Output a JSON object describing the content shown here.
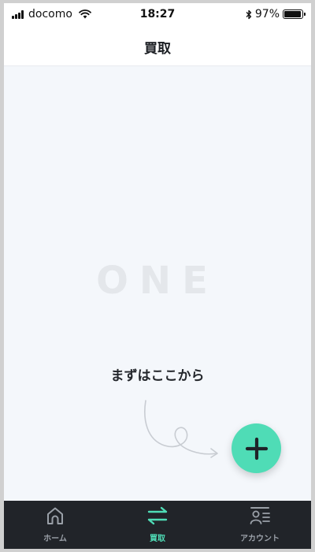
{
  "status_bar": {
    "carrier": "docomo",
    "time": "18:27",
    "battery": "97%",
    "battery_level": 0.97,
    "icons": [
      "signal-icon",
      "wifi-icon",
      "bluetooth-icon",
      "battery-icon"
    ]
  },
  "nav": {
    "title": "買取"
  },
  "content": {
    "brand_logo_text": "ONE",
    "prompt": "まずはここから",
    "fab_icon": "plus-icon"
  },
  "tabs": [
    {
      "label": "ホーム",
      "icon": "home-icon",
      "active": false
    },
    {
      "label": "買取",
      "icon": "exchange-arrows-icon",
      "active": true
    },
    {
      "label": "アカウント",
      "icon": "account-icon",
      "active": false
    }
  ],
  "colors": {
    "accent": "#4fdcb6",
    "tabbar_bg": "#212429",
    "content_bg": "#f4f7fb",
    "inactive_tab": "#9aa0a8",
    "logo": "#e4e7eb"
  }
}
